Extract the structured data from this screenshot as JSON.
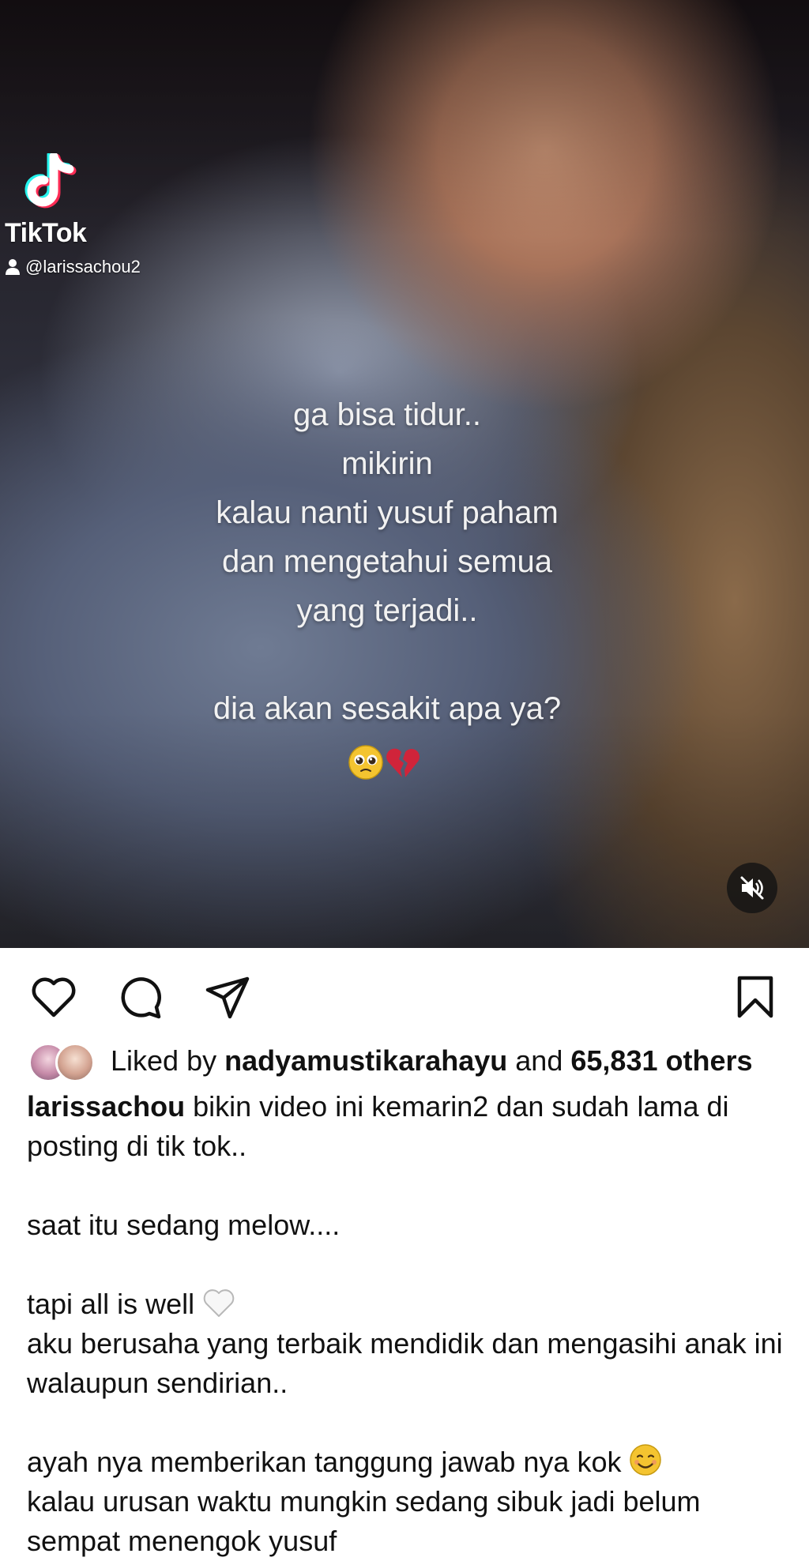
{
  "video": {
    "watermark_brand": "TikTok",
    "watermark_handle": "@larissachou2",
    "overlay_lines": [
      "ga bisa tidur..",
      "mikirin",
      "kalau nanti yusuf paham",
      "dan mengetahui semua",
      "yang terjadi..",
      "",
      "dia akan sesakit apa ya?"
    ],
    "overlay_emojis": [
      "pleading-face-emoji",
      "broken-heart-emoji"
    ],
    "mute_icon": "speaker-muted-icon"
  },
  "actions": {
    "icons": [
      "heart-icon",
      "comment-icon",
      "share-icon",
      "bookmark-icon"
    ]
  },
  "likes": {
    "prefix": "Liked by",
    "user": "nadyamustikarahayu",
    "joiner": "and",
    "count": "65,831 others"
  },
  "caption": {
    "username": "larissachou",
    "line1": " bikin video ini kemarin2 dan sudah lama di posting di tik tok..",
    "line2": "saat itu sedang melow....",
    "line3": "tapi all is well",
    "line4": "aku berusaha yang terbaik mendidik dan mengasihi anak ini walaupun sendirian..",
    "line5": "ayah nya memberikan tanggung jawab nya kok",
    "line6": "kalau urusan waktu mungkin sedang sibuk jadi belum sempat menengok yusuf"
  },
  "colors": {
    "text": "#111111",
    "tiktok_cyan": "#25F4EE",
    "tiktok_red": "#FE2C55",
    "broken_heart": "#D0243A"
  }
}
